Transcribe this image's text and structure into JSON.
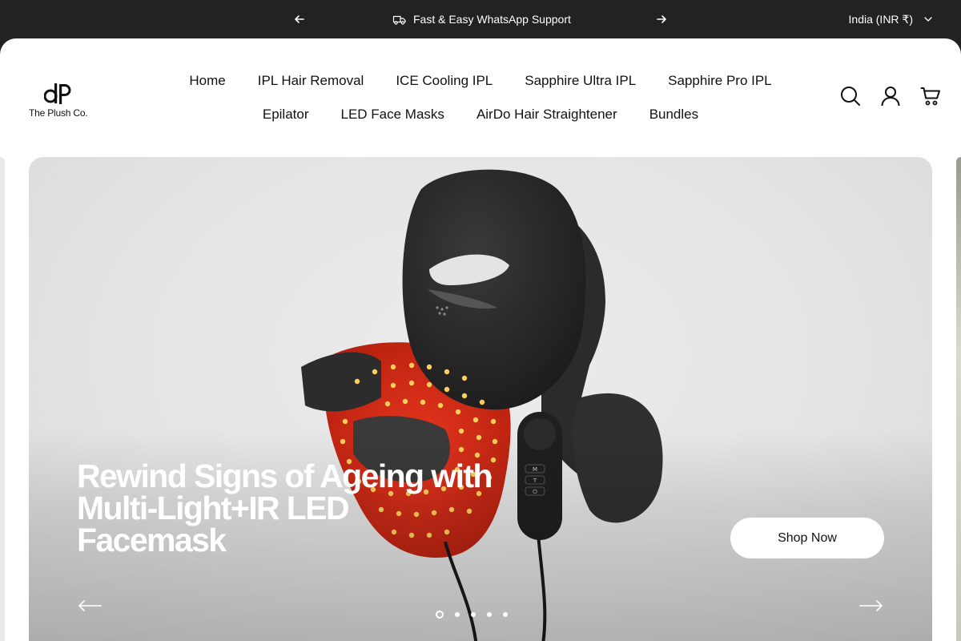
{
  "announcement": {
    "message": "Fast & Easy WhatsApp Support",
    "region": "India (INR ₹)",
    "icons": {
      "prev": "arrow-left-icon",
      "next": "arrow-right-icon",
      "message": "truck-icon",
      "region": "chevron-down-icon"
    }
  },
  "brand": {
    "logo_text": "The Plush Co."
  },
  "nav": {
    "row1": [
      "Home",
      "IPL Hair Removal",
      "ICE Cooling IPL",
      "Sapphire Ultra IPL",
      "Sapphire Pro IPL"
    ],
    "row2": [
      "Epilator",
      "LED Face Masks",
      "AirDo Hair Straightener",
      "Bundles"
    ]
  },
  "header_icons": [
    "search-icon",
    "account-icon",
    "cart-icon"
  ],
  "hero": {
    "title_lines": [
      "Rewind Signs of Ageing with",
      "Multi-Light+IR LED",
      "Facemask"
    ],
    "cta_label": "Shop Now",
    "slide_count": 5,
    "active_slide": 1,
    "icons": {
      "prev": "long-arrow-left-icon",
      "next": "long-arrow-right-icon"
    }
  },
  "colors": {
    "topbar_bg": "#222222",
    "page_bg": "#ffffff",
    "led_red": "#d8301c",
    "mask_black": "#2a2a2a"
  }
}
